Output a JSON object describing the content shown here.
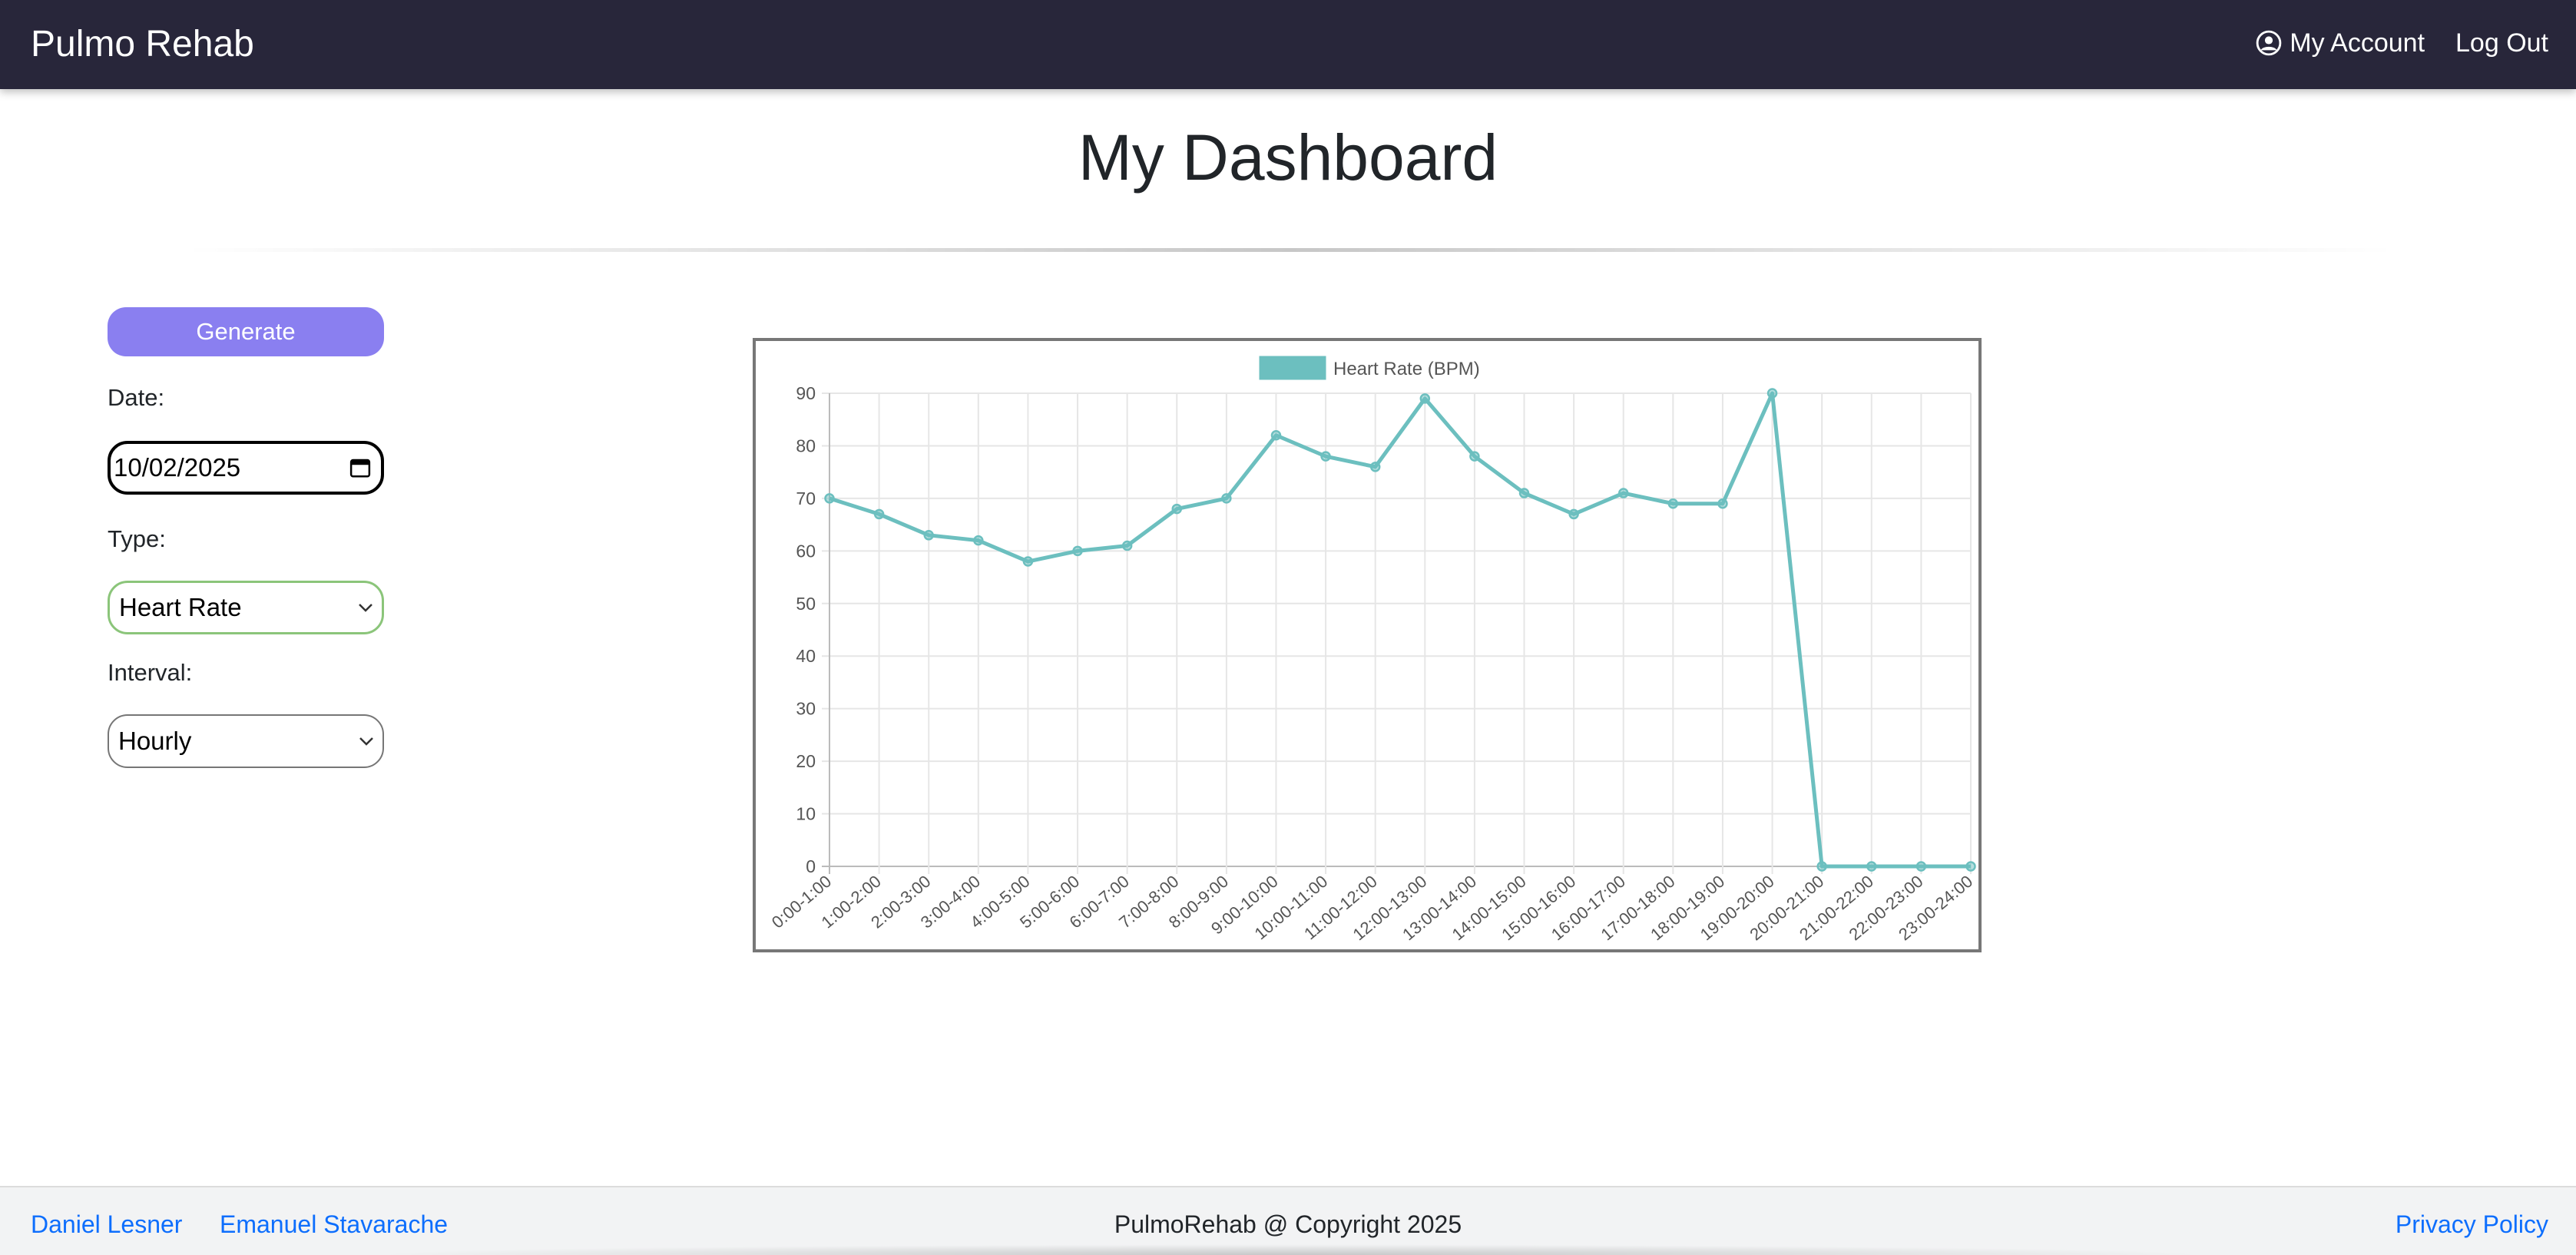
{
  "nav": {
    "brand": "Pulmo Rehab",
    "account_label": "My Account",
    "logout_label": "Log Out"
  },
  "page": {
    "title": "My Dashboard"
  },
  "controls": {
    "generate_label": "Generate",
    "date_label": "Date:",
    "date_value": "10/02/2025",
    "type_label": "Type:",
    "type_value": "Heart Rate",
    "interval_label": "Interval:",
    "interval_value": "Hourly"
  },
  "colors": {
    "navbar": "#28263a",
    "accent": "#8a7ff0",
    "series": "#6cbfbf",
    "link": "#0d6efd"
  },
  "chart_data": {
    "type": "line",
    "legend_position": "top",
    "grid": true,
    "ylim": [
      0,
      90
    ],
    "yticks": [
      0,
      10,
      20,
      30,
      40,
      50,
      60,
      70,
      80,
      90
    ],
    "categories": [
      "0:00-1:00",
      "1:00-2:00",
      "2:00-3:00",
      "3:00-4:00",
      "4:00-5:00",
      "5:00-6:00",
      "6:00-7:00",
      "7:00-8:00",
      "8:00-9:00",
      "9:00-10:00",
      "10:00-11:00",
      "11:00-12:00",
      "12:00-13:00",
      "13:00-14:00",
      "14:00-15:00",
      "15:00-16:00",
      "16:00-17:00",
      "17:00-18:00",
      "18:00-19:00",
      "19:00-20:00",
      "20:00-21:00",
      "21:00-22:00",
      "22:00-23:00",
      "23:00-24:00"
    ],
    "series": [
      {
        "name": "Heart Rate (BPM)",
        "color": "#6cbfbf",
        "values": [
          70,
          67,
          63,
          62,
          58,
          60,
          61,
          68,
          70,
          82,
          78,
          76,
          89,
          78,
          71,
          67,
          71,
          69,
          69,
          90,
          0,
          0,
          0,
          0
        ]
      }
    ]
  },
  "footer": {
    "author1": "Daniel Lesner",
    "author2": "Emanuel Stavarache",
    "copyright": "PulmoRehab @ Copyright 2025",
    "privacy": "Privacy Policy"
  }
}
